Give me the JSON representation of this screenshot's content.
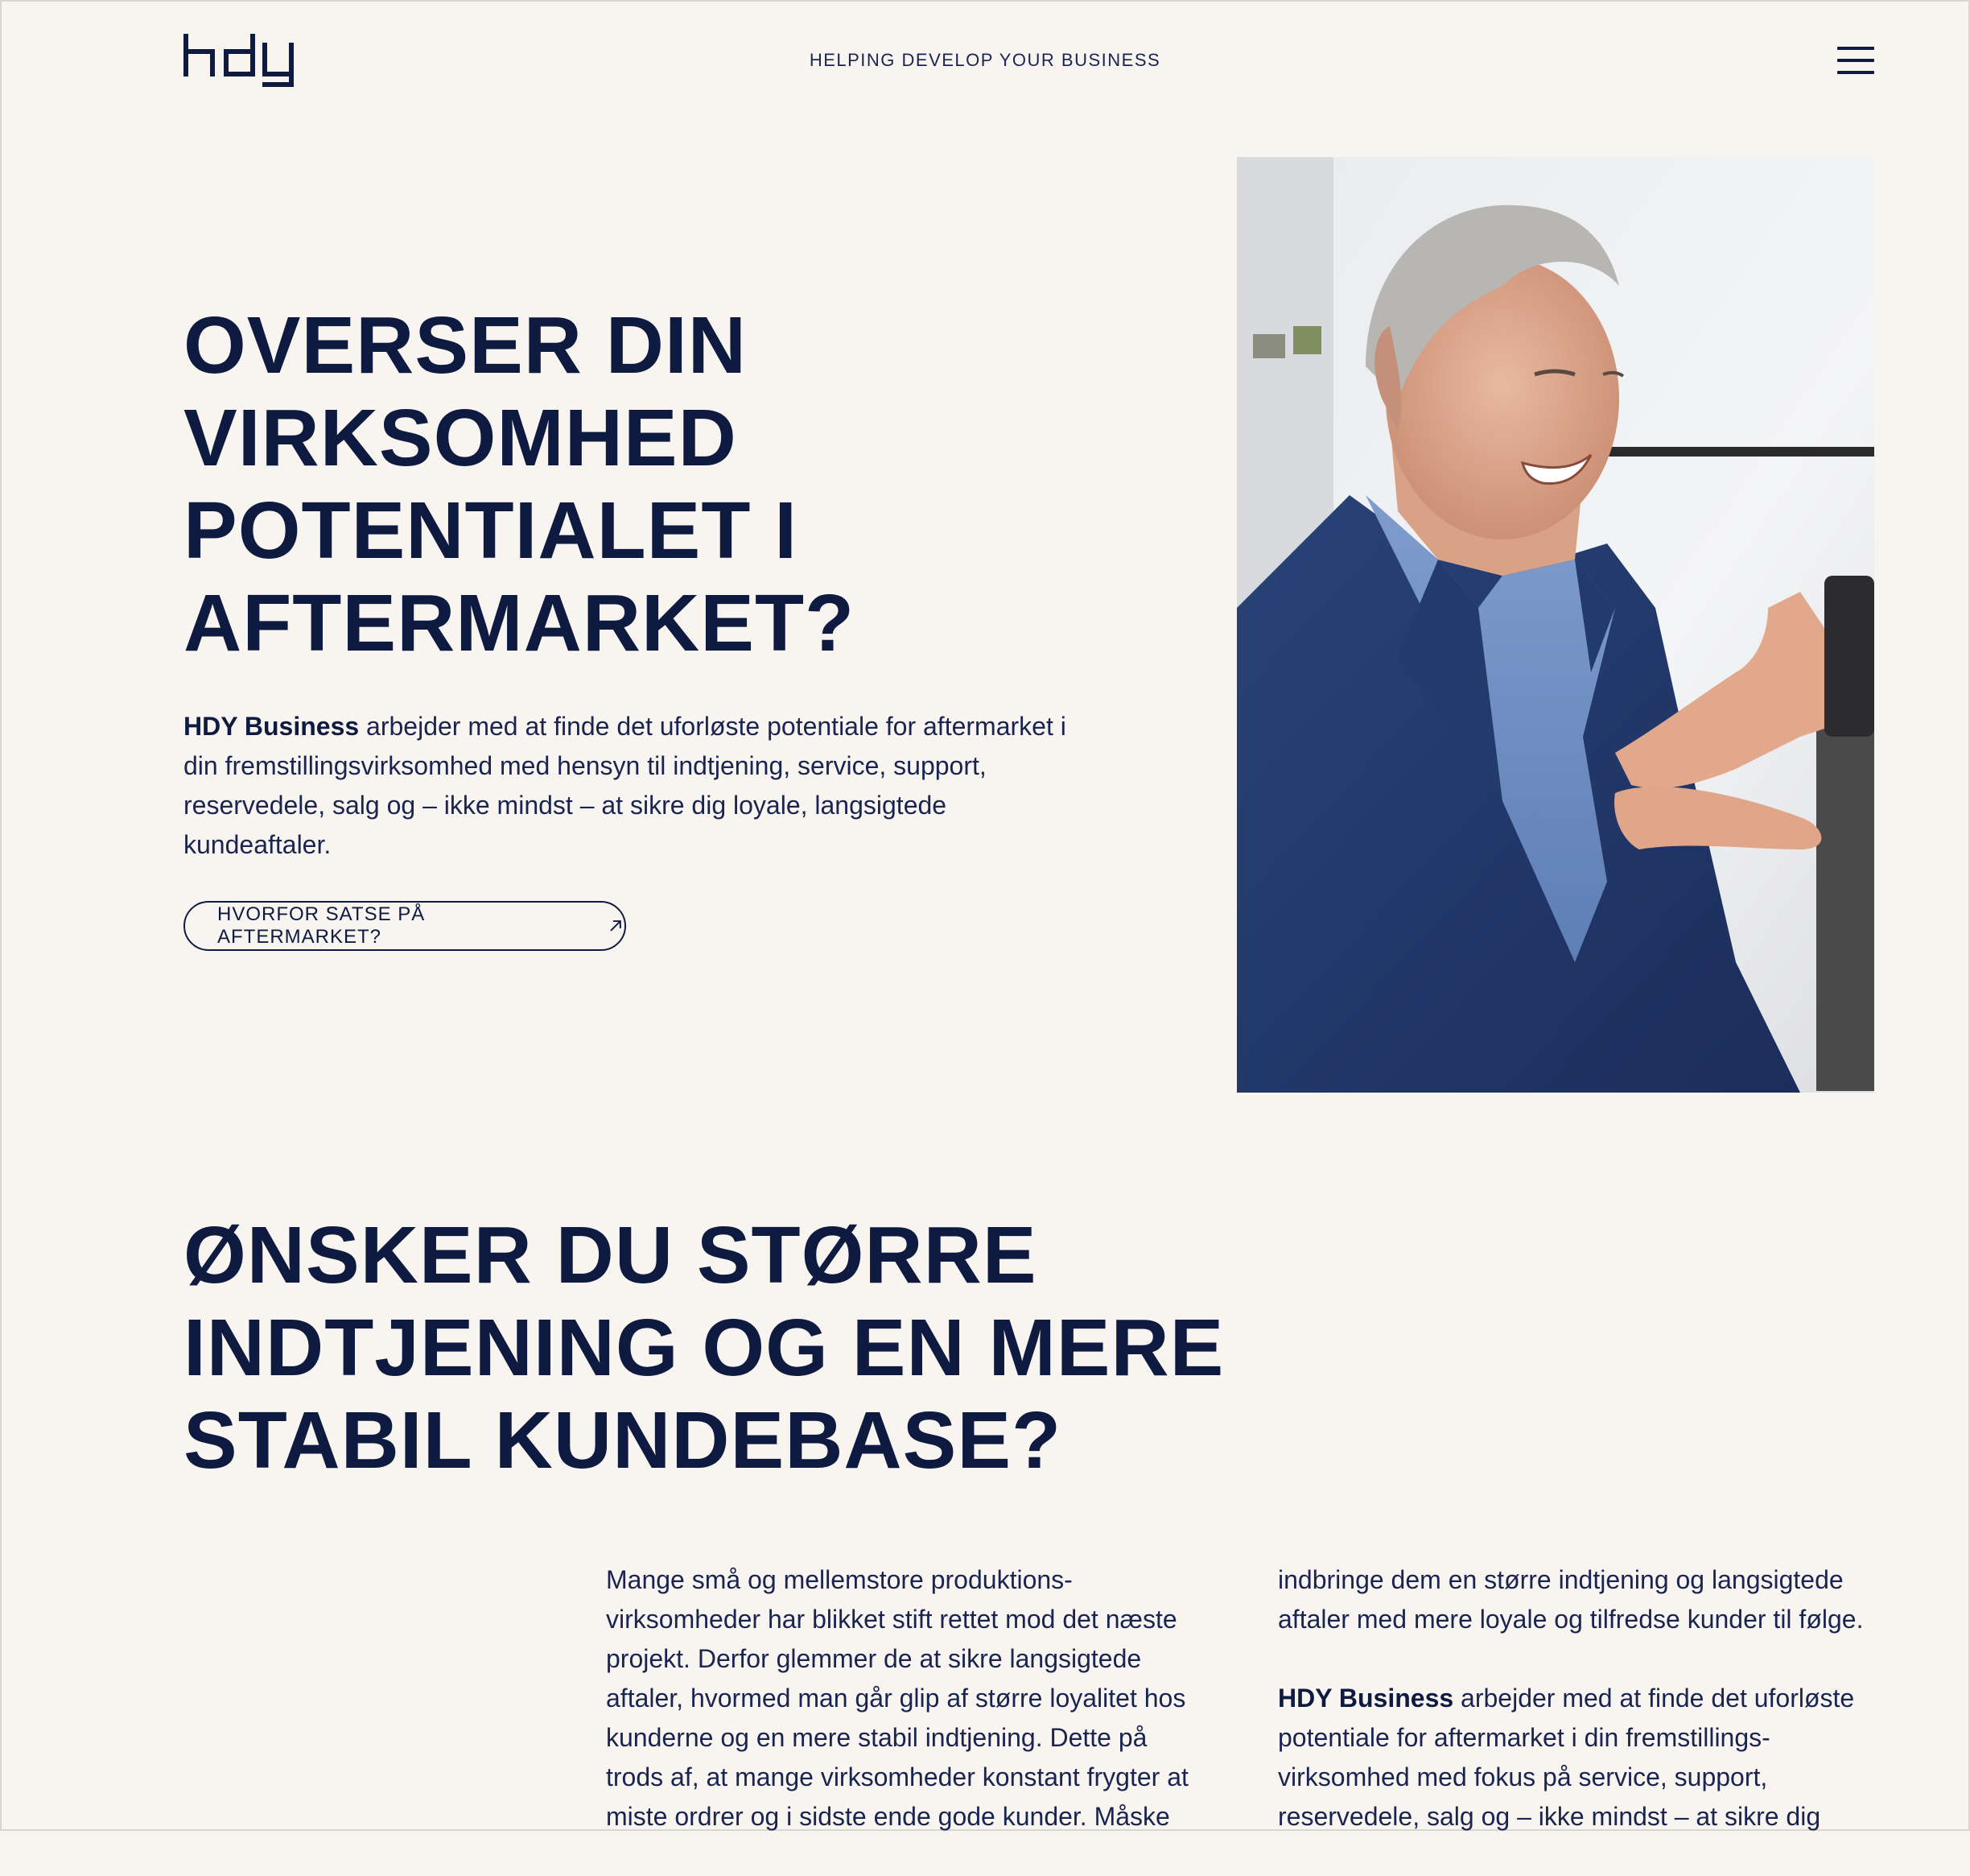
{
  "header": {
    "logo_text": "hdy",
    "tagline": "HELPING DEVELOP YOUR BUSINESS",
    "menu_icon": "hamburger-menu-icon"
  },
  "hero": {
    "title_lines": [
      "OVERSER DIN",
      "VIRKSOMHED",
      "POTENTIALET I",
      "AFTERMARKET?"
    ],
    "intro_bold": "HDY Business",
    "intro_text": " arbejder med at finde det uforløste potentiale for aftermarket i din fremstillingsvirksomhed med hensyn til indtjening, service, support, reservedele, salg og – ikke mindst – at sikre dig loyale, langsigtede kundeaftaler.",
    "cta_label": "HVORFOR SATSE PÅ AFTERMARKET?",
    "cta_icon": "arrow-up-right-icon"
  },
  "section2": {
    "title_lines": [
      "ØNSKER DU STØRRE",
      "INDTJENING OG EN MERE",
      "STABIL KUNDEBASE?"
    ],
    "col1_text": "Mange små og mellemstore produktions-virksomheder har blikket stift rettet mod det næste projekt. Derfor glemmer de at sikre langsigtede aftaler, hvormed man går glip af større loyalitet hos kunderne og en mere stabil indtjening. Dette på trods af, at mange virksomheder konstant frygter at miste ordrer og i sidste ende gode kunder. Måske",
    "col2_text1": "indbringe dem en større indtjening og langsigtede aftaler med mere loyale og tilfredse kunder til følge.",
    "col2_bold": "HDY Business",
    "col2_text2": " arbejder med at finde det uforløste potentiale for aftermarket i din fremstillings-virksomhed med fokus på service, support, reservedele, salg og – ikke mindst – at sikre dig"
  },
  "colors": {
    "background": "#f8f5f1",
    "navy": "#0f1a40"
  }
}
